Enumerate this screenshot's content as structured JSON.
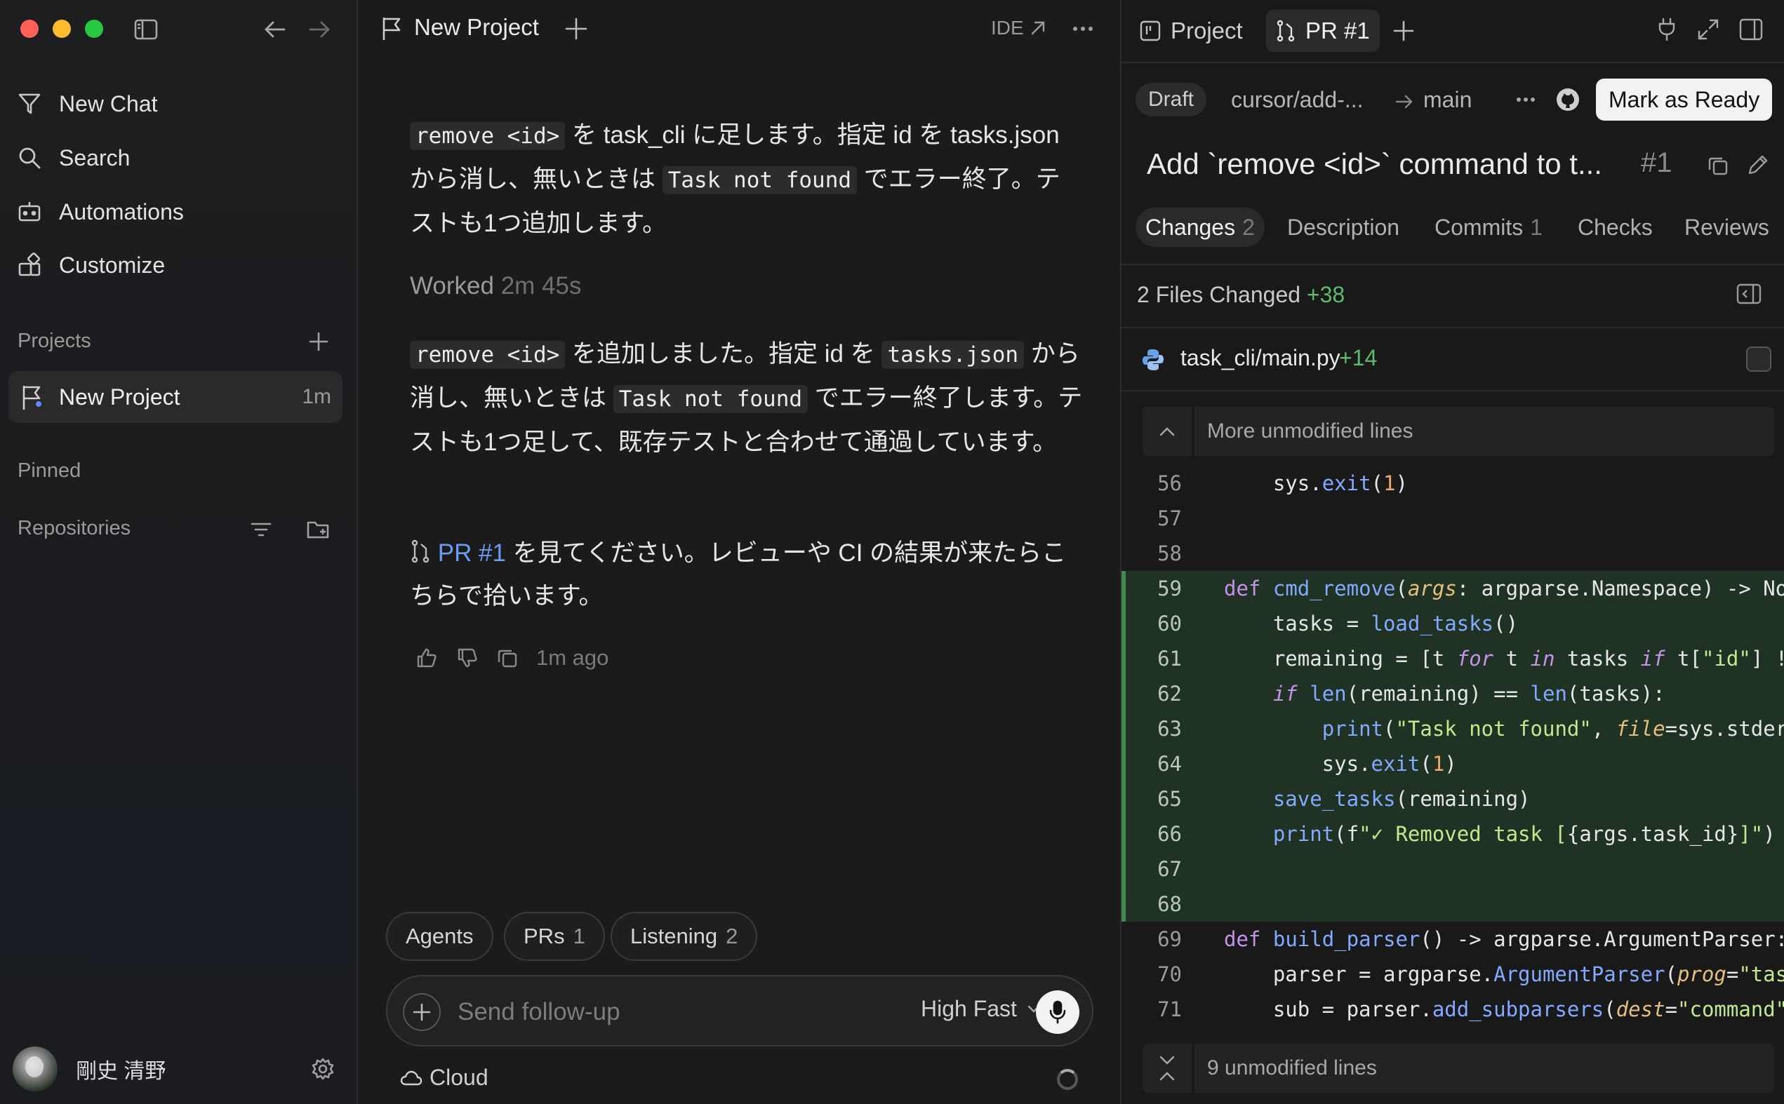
{
  "sidebar": {
    "nav": [
      {
        "label": "New Chat",
        "icon": "new-chat-icon"
      },
      {
        "label": "Search",
        "icon": "search-icon"
      },
      {
        "label": "Automations",
        "icon": "automations-icon"
      },
      {
        "label": "Customize",
        "icon": "customize-icon"
      }
    ],
    "projects_label": "Projects",
    "project": {
      "name": "New Project",
      "age": "1m"
    },
    "pinned_label": "Pinned",
    "repositories_label": "Repositories",
    "user_name": "剛史 清野"
  },
  "chat": {
    "title": "New Project",
    "ide_label": "IDE",
    "msg1": {
      "code1": "remove <id>",
      "t1": " を task_cli に足します。指定 id を tasks.json から消し、無いときは ",
      "code2": "Task not found",
      "t2": " でエラー終了。テストも1つ追加します。"
    },
    "worked": {
      "label": "Worked",
      "duration": "2m 45s"
    },
    "msg2": {
      "code1": "remove <id>",
      "t1": " を追加しました。指定 id を ",
      "code2": "tasks.json",
      "t2": " から消し、無いときは ",
      "code3": "Task not found",
      "t3": " でエラー終了します。テストも1つ足して、既存テストと合わせて通過しています。"
    },
    "msg3": {
      "link": "PR #1",
      "t1": " を見てください。レビューや CI の結果が来たらこちらで拾います。"
    },
    "time_ago": "1m ago",
    "pills": [
      {
        "label": "Agents",
        "count": ""
      },
      {
        "label": "PRs",
        "count": "1"
      },
      {
        "label": "Listening",
        "count": "2"
      }
    ],
    "composer_placeholder": "Send follow-up",
    "model": "High Fast",
    "env": "Cloud"
  },
  "pr": {
    "tabs": [
      {
        "label": "Project"
      },
      {
        "label": "PR #1"
      }
    ],
    "status": "Draft",
    "branch_from": "cursor/add-...",
    "branch_to": "main",
    "mark_ready": "Mark as Ready",
    "title": "Add `remove <id>` command to t...",
    "number": "#1",
    "subtabs": [
      {
        "label": "Changes",
        "count": "2"
      },
      {
        "label": "Description",
        "count": ""
      },
      {
        "label": "Commits",
        "count": "1"
      },
      {
        "label": "Checks",
        "count": ""
      },
      {
        "label": "Reviews",
        "count": ""
      }
    ],
    "files_changed": "2 Files Changed",
    "files_additions": "+38",
    "file": {
      "name": "task_cli/main.py",
      "additions": "+14"
    },
    "unmodified_top": "More unmodified lines",
    "unmodified_bottom": "9 unmodified lines",
    "line_numbers": [
      "56",
      "57",
      "58",
      "59",
      "60",
      "61",
      "62",
      "63",
      "64",
      "65",
      "66",
      "67",
      "68",
      "69",
      "70",
      "71"
    ]
  }
}
